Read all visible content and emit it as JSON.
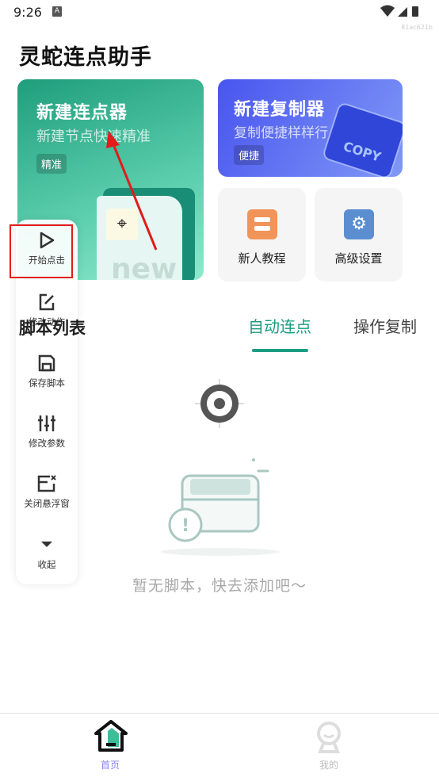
{
  "status_bar": {
    "time": "9:26",
    "notification_icon": "A",
    "icons": [
      "wifi-icon",
      "signal-icon",
      "battery-charging-icon"
    ],
    "build_id": "81ac621b"
  },
  "app_title": "灵蛇连点助手",
  "cards": {
    "new_clicker": {
      "title": "新建连点器",
      "subtitle": "新建节点快速精准",
      "tag": "精准",
      "illustration_text": "new"
    },
    "new_copier": {
      "title": "新建复制器",
      "subtitle": "复制便捷样样行",
      "tag": "便捷",
      "illustration_text": "COPY"
    },
    "tutorial": {
      "label": "新人教程",
      "color": "#f0945a"
    },
    "settings": {
      "label": "高级设置",
      "color": "#5b8ed0"
    }
  },
  "section": {
    "title": "脚本列表",
    "tabs": [
      {
        "label": "自动连点",
        "active": true
      },
      {
        "label": "操作复制",
        "active": false
      }
    ]
  },
  "empty_state": {
    "text": "暂无脚本，快去添加吧～"
  },
  "floating_panel": {
    "items": [
      {
        "label": "开始点击",
        "icon": "play-icon",
        "highlighted": true
      },
      {
        "label": "修改动作",
        "icon": "edit-icon"
      },
      {
        "label": "保存脚本",
        "icon": "save-icon"
      },
      {
        "label": "修改参数",
        "icon": "sliders-icon"
      },
      {
        "label": "关闭悬浮窗",
        "icon": "close-window-icon"
      },
      {
        "label": "收起",
        "icon": "caret-down-icon"
      }
    ]
  },
  "bottom_nav": [
    {
      "label": "首页",
      "active": true
    },
    {
      "label": "我的",
      "active": false
    }
  ],
  "colors": {
    "accent": "#1a9d82",
    "nav_active": "#8a85f0",
    "annotation": "#e21b1b"
  }
}
